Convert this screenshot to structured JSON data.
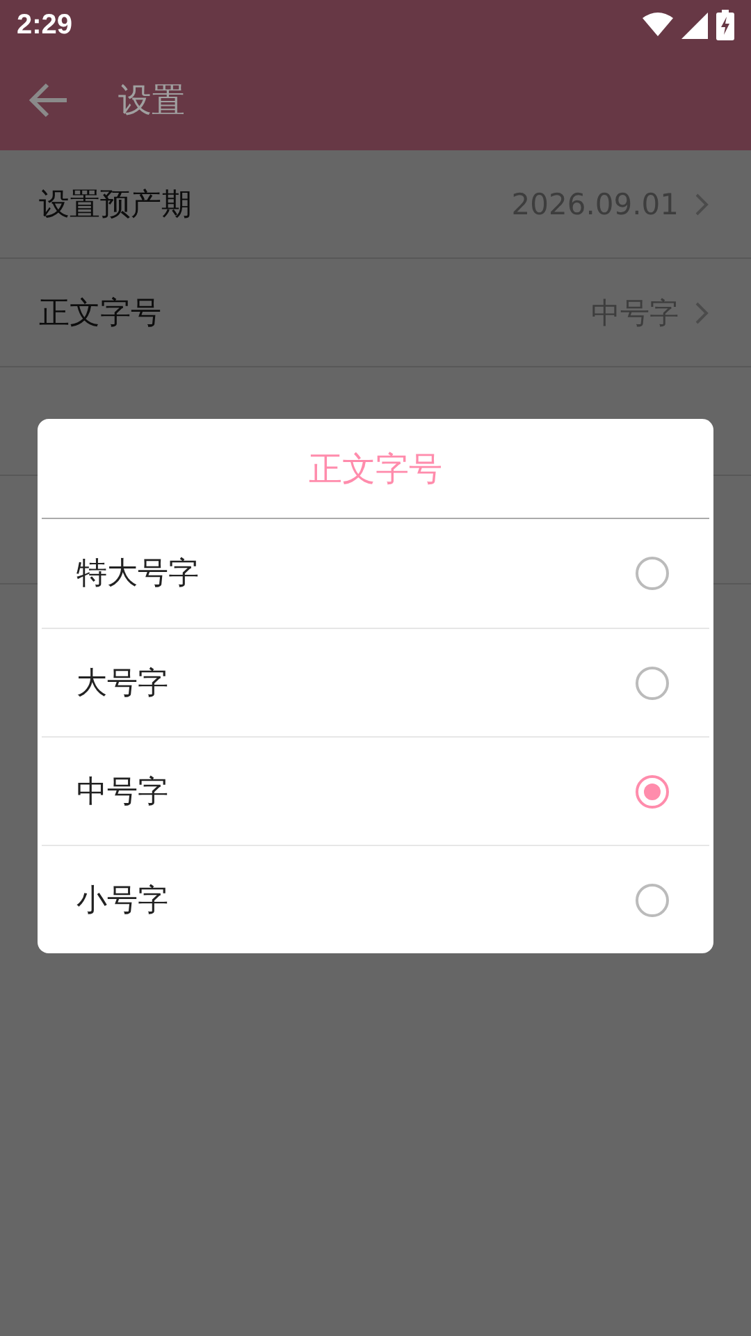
{
  "status_bar": {
    "time": "2:29"
  },
  "toolbar": {
    "title": "设置"
  },
  "settings": [
    {
      "label": "设置预产期",
      "value": "2026.09.01"
    },
    {
      "label": "正文字号",
      "value": "中号字"
    }
  ],
  "dialog": {
    "title": "正文字号",
    "options": [
      {
        "label": "特大号字",
        "selected": false
      },
      {
        "label": "大号字",
        "selected": false
      },
      {
        "label": "中号字",
        "selected": true
      },
      {
        "label": "小号字",
        "selected": false
      }
    ]
  }
}
